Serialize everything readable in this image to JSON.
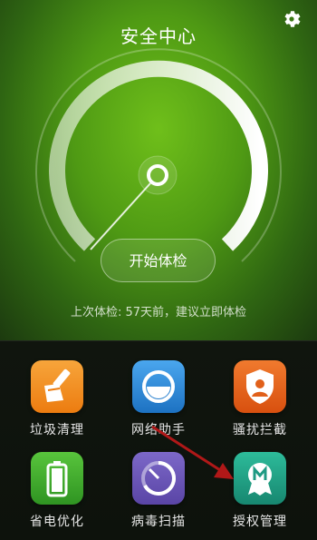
{
  "header": {
    "title": "安全中心",
    "settings_icon": "gear-icon"
  },
  "gauge": {
    "colors": {
      "arc": "#ffffff",
      "needle": "#ffffff"
    }
  },
  "start_check": {
    "label": "开始体检"
  },
  "status_text": "上次体检: 57天前，建议立即体检",
  "tiles": [
    {
      "label": "垃圾清理",
      "icon": "broom-icon",
      "color": "#f08a1d"
    },
    {
      "label": "网络助手",
      "icon": "network-icon",
      "color": "#2a86d6"
    },
    {
      "label": "骚扰拦截",
      "icon": "shield-user-icon",
      "color": "#e55a17"
    },
    {
      "label": "省电优化",
      "icon": "battery-icon",
      "color": "#39a52c"
    },
    {
      "label": "病毒扫描",
      "icon": "scan-icon",
      "color": "#6a55b8"
    },
    {
      "label": "授权管理",
      "icon": "permission-icon",
      "color": "#1f9a83"
    }
  ],
  "annotation": {
    "arrow_color": "#b01818"
  }
}
